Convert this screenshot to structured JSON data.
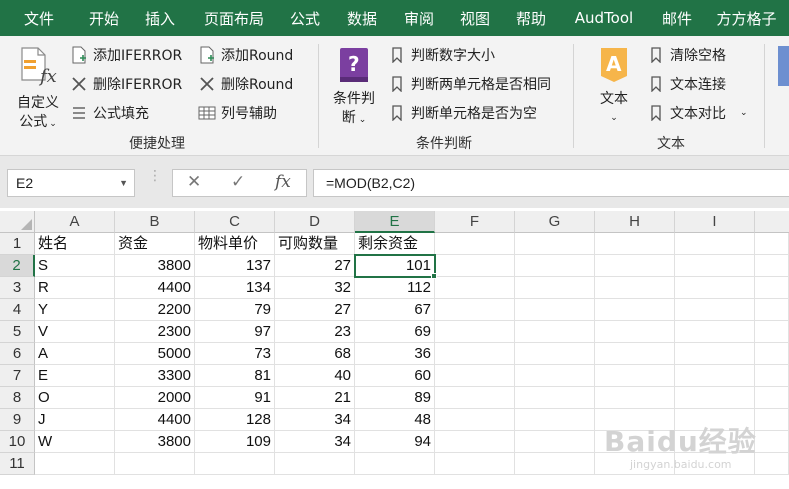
{
  "menubar": {
    "tabs": [
      "文件",
      "开始",
      "插入",
      "页面布局",
      "公式",
      "数据",
      "审阅",
      "视图",
      "帮助",
      "AudTool",
      "邮件",
      "方方格子"
    ]
  },
  "ribbon": {
    "custom_formula": {
      "line1": "自定义",
      "line2": "公式"
    },
    "quick_group": {
      "label": "便捷处理",
      "add_iferror": "添加IFERROR",
      "del_iferror": "删除IFERROR",
      "formula_fill": "公式填充",
      "add_round": "添加Round",
      "del_round": "删除Round",
      "col_helper": "列号辅助"
    },
    "cond_group": {
      "label": "条件判断",
      "big_line1": "条件判",
      "big_line2": "断",
      "item1": "判断数字大小",
      "item2": "判断两单元格是否相同",
      "item3": "判断单元格是否为空"
    },
    "text_group": {
      "label": "文本",
      "big_label": "文本",
      "item1": "清除空格",
      "item2": "文本连接",
      "item3": "文本对比"
    }
  },
  "formula_bar": {
    "name_box": "E2",
    "cancel_glyph": "✕",
    "enter_glyph": "✓",
    "fx_glyph": "fx",
    "formula": "=MOD(B2,C2)"
  },
  "sheet": {
    "columns": [
      "A",
      "B",
      "C",
      "D",
      "E",
      "F",
      "G",
      "H",
      "I"
    ],
    "row_numbers": [
      "1",
      "2",
      "3",
      "4",
      "5",
      "6",
      "7",
      "8",
      "9",
      "10",
      "11"
    ],
    "headers": [
      "姓名",
      "资金",
      "物料单价",
      "可购数量",
      "剩余资金"
    ],
    "rows": [
      [
        "S",
        "3800",
        "137",
        "27",
        "101"
      ],
      [
        "R",
        "4400",
        "134",
        "32",
        "112"
      ],
      [
        "Y",
        "2200",
        "79",
        "27",
        "67"
      ],
      [
        "V",
        "2300",
        "97",
        "23",
        "69"
      ],
      [
        "A",
        "5000",
        "73",
        "68",
        "36"
      ],
      [
        "E",
        "3300",
        "81",
        "40",
        "60"
      ],
      [
        "O",
        "2000",
        "91",
        "21",
        "89"
      ],
      [
        "J",
        "4400",
        "128",
        "34",
        "48"
      ],
      [
        "W",
        "3800",
        "109",
        "34",
        "94"
      ]
    ],
    "selected_cell": "E2"
  },
  "watermark": {
    "main": "Baidu经验",
    "sub": "jingyan.baidu.com"
  },
  "colors": {
    "accent": "#217346",
    "ribbon_bg": "#f3f3f3",
    "purple_icon": "#7b3fa0",
    "orange_icon": "#f0a030"
  }
}
